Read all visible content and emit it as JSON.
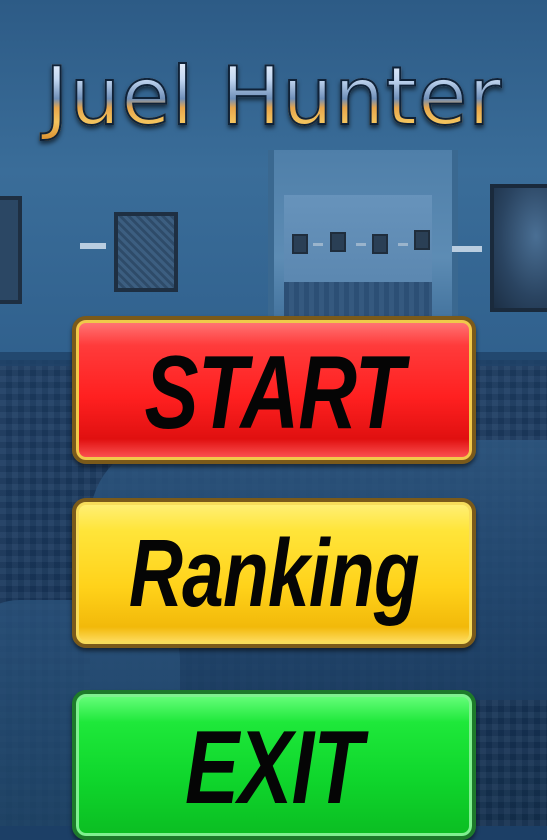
{
  "game": {
    "title": "Juel Hunter"
  },
  "menu": {
    "start_label": "START",
    "ranking_label": "Ranking",
    "exit_label": "EXIT"
  },
  "colors": {
    "start_button": "#ff2020",
    "ranking_button": "#ffd21a",
    "exit_button": "#0fd62c",
    "background": "#2d5b86"
  }
}
